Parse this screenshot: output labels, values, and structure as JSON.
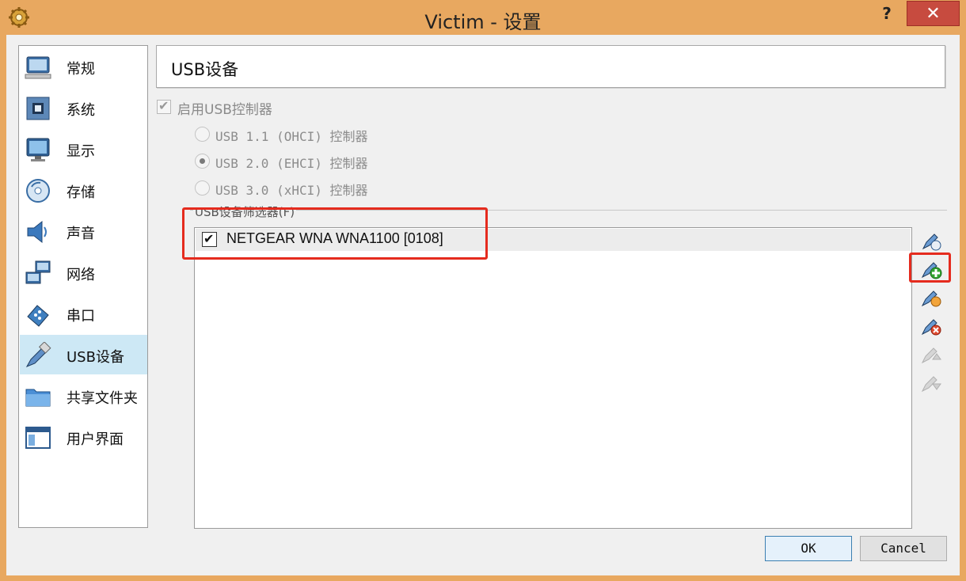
{
  "window": {
    "title": "Victim - 设置",
    "help_label": "?",
    "close_label": "✕",
    "app_icon": "gear-icon"
  },
  "sidebar": {
    "items": [
      {
        "label": "常规",
        "icon": "monitor-icon",
        "selected": false
      },
      {
        "label": "系统",
        "icon": "chip-icon",
        "selected": false
      },
      {
        "label": "显示",
        "icon": "display-icon",
        "selected": false
      },
      {
        "label": "存储",
        "icon": "disk-icon",
        "selected": false
      },
      {
        "label": "声音",
        "icon": "speaker-icon",
        "selected": false
      },
      {
        "label": "网络",
        "icon": "network-icon",
        "selected": false
      },
      {
        "label": "串口",
        "icon": "serial-port-icon",
        "selected": false
      },
      {
        "label": "USB设备",
        "icon": "usb-icon",
        "selected": true
      },
      {
        "label": "共享文件夹",
        "icon": "folder-icon",
        "selected": false
      },
      {
        "label": "用户界面",
        "icon": "window-icon",
        "selected": false
      }
    ]
  },
  "page": {
    "title": "USB设备",
    "enable_usb_label": "启用USB控制器",
    "enable_usb_checked": true,
    "usb_options": [
      {
        "label": "USB 1.1 (OHCI) 控制器",
        "selected": false
      },
      {
        "label": "USB 2.0 (EHCI) 控制器",
        "selected": true
      },
      {
        "label": "USB 3.0 (xHCI) 控制器",
        "selected": false
      }
    ],
    "filters_label": "USB设备筛选器(F)",
    "filters": [
      {
        "label": "NETGEAR WNA WNA1100 [0108]",
        "checked": true
      }
    ],
    "tool_buttons": [
      {
        "icon": "usb-filter-add-empty-icon",
        "enabled": true
      },
      {
        "icon": "usb-filter-add-from-device-icon",
        "enabled": true,
        "highlighted": true
      },
      {
        "icon": "usb-filter-edit-icon",
        "enabled": true
      },
      {
        "icon": "usb-filter-remove-icon",
        "enabled": true
      },
      {
        "icon": "usb-filter-move-up-icon",
        "enabled": false
      },
      {
        "icon": "usb-filter-move-down-icon",
        "enabled": false
      }
    ]
  },
  "footer": {
    "ok_label": "OK",
    "cancel_label": "Cancel"
  },
  "colors": {
    "frame": "#e8a860",
    "close": "#c74b3f",
    "selection": "#cde8f5",
    "highlight": "#e52b1e"
  }
}
